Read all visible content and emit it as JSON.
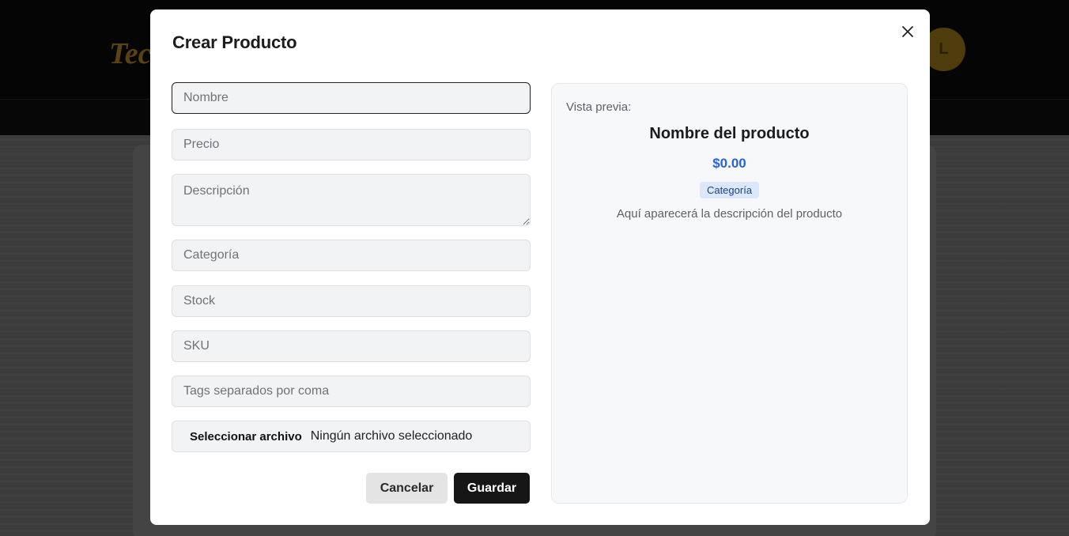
{
  "background": {
    "logo_text": "Tec",
    "avatar_initial": "L"
  },
  "modal": {
    "title": "Crear Producto",
    "close_icon": "close-icon"
  },
  "form": {
    "name": {
      "placeholder": "Nombre",
      "value": ""
    },
    "price": {
      "placeholder": "Precio",
      "value": ""
    },
    "description": {
      "placeholder": "Descripción",
      "value": ""
    },
    "category": {
      "placeholder": "Categoría",
      "value": ""
    },
    "stock": {
      "placeholder": "Stock",
      "value": ""
    },
    "sku": {
      "placeholder": "SKU",
      "value": ""
    },
    "tags": {
      "placeholder": "Tags separados por coma",
      "value": ""
    },
    "file": {
      "button_label": "Seleccionar archivo",
      "status": "Ningún archivo seleccionado"
    }
  },
  "actions": {
    "cancel_label": "Cancelar",
    "save_label": "Guardar"
  },
  "preview": {
    "label": "Vista previa:",
    "name": "Nombre del producto",
    "price": "$0.00",
    "category": "Categoría",
    "description": "Aquí aparecerá la descripción del producto"
  },
  "colors": {
    "price_accent": "#2563d6",
    "badge_bg": "#dbe8fb",
    "save_button_bg": "#161616"
  }
}
